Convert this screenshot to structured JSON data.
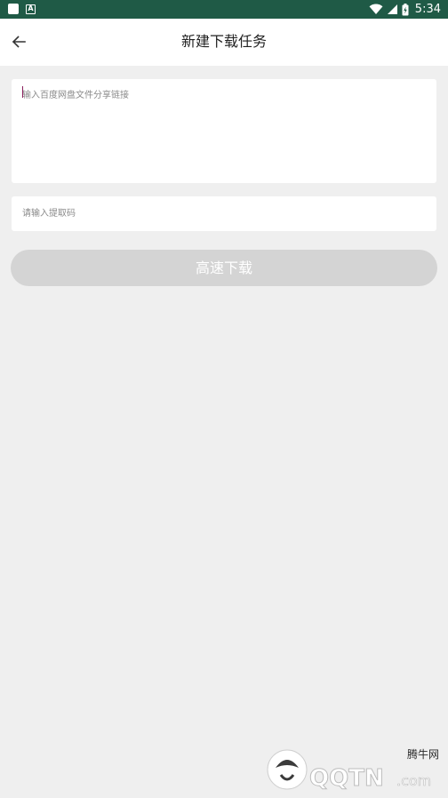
{
  "status_bar": {
    "time": "5:34",
    "icons": [
      "square-notification-icon",
      "a-notification-icon",
      "wifi-icon",
      "signal-icon",
      "battery-icon"
    ]
  },
  "header": {
    "title": "新建下载任务",
    "back_icon": "arrow-left-icon"
  },
  "form": {
    "link_placeholder": "输入百度网盘文件分享链接",
    "link_value": "",
    "code_placeholder": "请输入提取码",
    "code_value": "",
    "submit_label": "高速下载"
  },
  "watermark": {
    "logo_text": "QQTN.com",
    "site_name": "腾牛网"
  },
  "colors": {
    "status_bar": "#1f5a46",
    "background": "#efefef",
    "button_disabled": "#d4d4d4",
    "caret": "#8a1f5c"
  }
}
